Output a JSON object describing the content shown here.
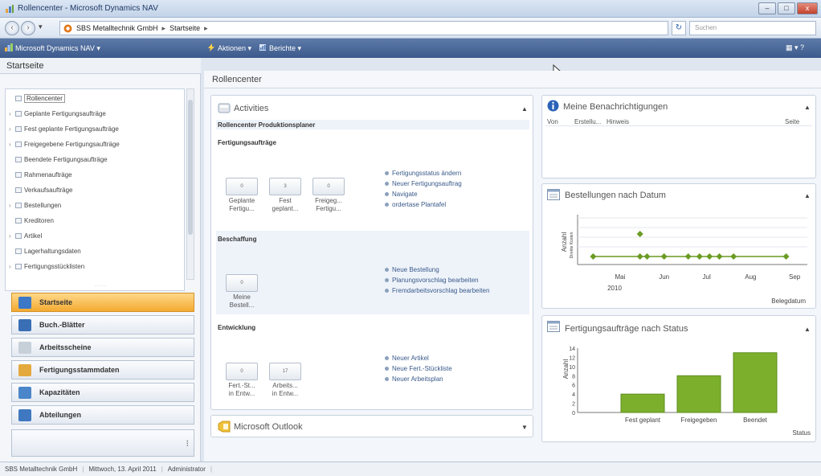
{
  "window": {
    "title": "Rollencenter - Microsoft Dynamics NAV",
    "buttons": {
      "minimize": "–",
      "maximize": "□",
      "close": "x"
    }
  },
  "address": {
    "back": "‹",
    "forward": "›",
    "history": "▾",
    "company": "SBS Metalltechnik GmbH",
    "page": "Startseite",
    "separator": "▸",
    "refresh": "↻",
    "search_placeholder": "Suchen"
  },
  "commandbar": {
    "app_menu": "Microsoft Dynamics NAV ▾",
    "actions": "Aktionen ▾",
    "reports": "Berichte ▾",
    "right_icons": "▦ ▾  ?"
  },
  "nav": {
    "header": "Startseite",
    "tree": [
      {
        "label": "Rollencenter",
        "arrow": "",
        "icon": "role-center-icon",
        "selected": true
      },
      {
        "label": "Geplante Fertigungsaufträge",
        "arrow": "›"
      },
      {
        "label": "Fest geplante Fertigungsaufträge",
        "arrow": "›"
      },
      {
        "label": "Freigegebene Fertigungsaufträge",
        "arrow": "›"
      },
      {
        "label": "Beendete Fertigungsaufträge",
        "arrow": ""
      },
      {
        "label": "Rahmenaufträge",
        "arrow": ""
      },
      {
        "label": "Verkaufsaufträge",
        "arrow": ""
      },
      {
        "label": "Bestellungen",
        "arrow": "›"
      },
      {
        "label": "Kreditoren",
        "arrow": ""
      },
      {
        "label": "Artikel",
        "arrow": "›"
      },
      {
        "label": "Lagerhaltungsdaten",
        "arrow": ""
      },
      {
        "label": "Fertigungsstücklisten",
        "arrow": "›"
      }
    ],
    "buttons": [
      {
        "label": "Startseite",
        "icon": "home-icon",
        "active": true,
        "color": "#3b78c8"
      },
      {
        "label": "Buch.-Blätter",
        "icon": "journal-icon",
        "color": "#3a6fb5"
      },
      {
        "label": "Arbeitsscheine",
        "icon": "worksheet-icon",
        "color": "#c7cfd9"
      },
      {
        "label": "Fertigungsstammdaten",
        "icon": "manufacturing-icon",
        "color": "#e3a93c"
      },
      {
        "label": "Kapazitäten",
        "icon": "capacity-icon",
        "color": "#4a86c9"
      },
      {
        "label": "Abteilungen",
        "icon": "departments-icon",
        "color": "#3f78c0"
      }
    ],
    "more": "⁝"
  },
  "content": {
    "header": "Rollencenter",
    "activities": {
      "title": "Activities",
      "subtitle": "Rollencenter Produktionsplaner",
      "sections": [
        {
          "name": "Fertigungsaufträge",
          "tiles": [
            {
              "line1": "Geplante",
              "line2": "Fertigu...",
              "value": "0"
            },
            {
              "line1": "Fest",
              "line2": "geplant...",
              "value": "3"
            },
            {
              "line1": "Freigeg...",
              "line2": "Fertigu...",
              "value": "0"
            }
          ],
          "links": [
            "Fertigungsstatus ändern",
            "Neuer Fertigungsauftrag",
            "Navigate",
            "ordertase Plantafel"
          ]
        },
        {
          "name": "Beschaffung",
          "tiles": [
            {
              "line1": "Meine",
              "line2": "Bestell...",
              "value": "0"
            }
          ],
          "links": [
            "Neue Bestellung",
            "Planungsvorschlag bearbeiten",
            "Fremdarbeitsvorschlag bearbeiten"
          ]
        },
        {
          "name": "Entwicklung",
          "tiles": [
            {
              "line1": "Fert.-St...",
              "line2": "in Entw...",
              "value": "0"
            },
            {
              "line1": "Arbeits...",
              "line2": "in Entw...",
              "value": "17"
            }
          ],
          "links": [
            "Neuer Artikel",
            "Neue Fert.-Stückliste",
            "Neuer Arbeitsplan"
          ]
        }
      ]
    },
    "outlook": {
      "title": "Microsoft Outlook"
    },
    "notifications": {
      "title": "Meine Benachrichtigungen",
      "columns": [
        "Von",
        "Erstellu...",
        "Hinweis",
        "Seite"
      ]
    },
    "orders_chart": {
      "title": "Bestellungen nach Datum",
      "ylabel": "Anzahl",
      "ylabel2": "Direkte Kosten",
      "xlabel": "Belegdatum",
      "year": "2010",
      "ticks": [
        "Mai",
        "Jun",
        "Jul",
        "Aug",
        "Sep"
      ],
      "color": "#6a9b22"
    },
    "status_chart": {
      "title": "Fertigungsaufträge nach Status",
      "ylabel": "Anzahl",
      "xlabel": "Status",
      "color": "#7cb02c"
    },
    "grip": "·····"
  },
  "statusbar": {
    "company": "SBS Metalltechnik GmbH",
    "date": "Mittwoch, 13. April 2011",
    "user": "Administrator"
  },
  "chart_data": [
    {
      "type": "scatter",
      "title": "Bestellungen nach Datum",
      "xlabel": "Belegdatum",
      "ylabel": "Anzahl",
      "x": [
        "2010-04-12",
        "2010-05-15",
        "2010-05-20",
        "2010-06-01",
        "2010-06-18",
        "2010-06-26",
        "2010-07-03",
        "2010-07-10",
        "2010-07-20",
        "2010-08-26"
      ],
      "y": [
        1,
        1,
        1,
        1,
        1,
        1,
        1,
        1,
        1,
        1
      ],
      "y_extra_point": {
        "x": "2010-05-15",
        "y": 2
      },
      "ticks": [
        "Mai",
        "Jun",
        "Jul",
        "Aug",
        "Sep"
      ]
    },
    {
      "type": "bar",
      "title": "Fertigungsaufträge nach Status",
      "xlabel": "Status",
      "ylabel": "Anzahl",
      "categories": [
        "Fest geplant",
        "Freigegeben",
        "Beendet"
      ],
      "values": [
        4,
        8,
        13
      ],
      "yticks": [
        0,
        2,
        4,
        6,
        8,
        10,
        12,
        14
      ],
      "ylim": [
        0,
        14
      ]
    }
  ]
}
